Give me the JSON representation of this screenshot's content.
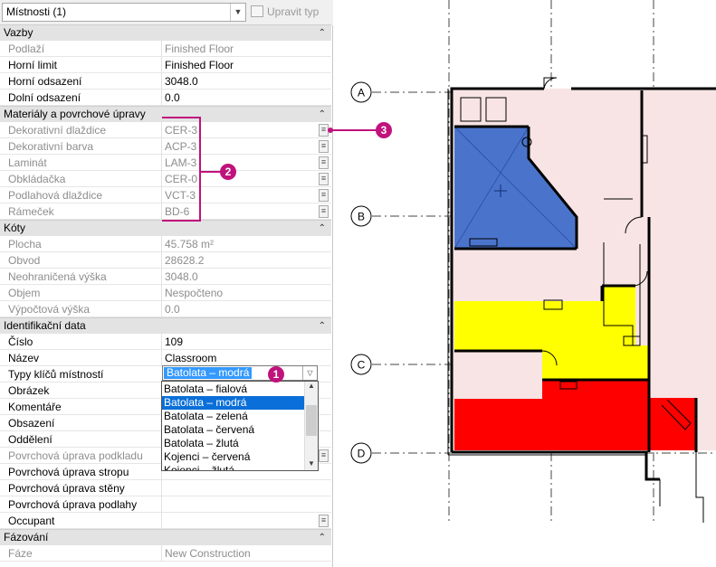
{
  "header": {
    "type_selector": "Místnosti (1)",
    "edit_type": "Upravit typ"
  },
  "groups": {
    "constraints": "Vazby",
    "materials": "Materiály a povrchové úpravy",
    "dimensions": "Kóty",
    "identity": "Identifikační data",
    "phasing": "Fázování"
  },
  "constraints": [
    {
      "label": "Podlaží",
      "value": "Finished Floor"
    },
    {
      "label": "Horní limit",
      "value": "Finished Floor"
    },
    {
      "label": "Horní odsazení",
      "value": "3048.0"
    },
    {
      "label": "Dolní odsazení",
      "value": "0.0"
    }
  ],
  "materials": [
    {
      "label": "Dekorativní dlaždice",
      "value": "CER-3"
    },
    {
      "label": "Dekorativní barva",
      "value": "ACP-3"
    },
    {
      "label": "Laminát",
      "value": "LAM-3"
    },
    {
      "label": "Obkládačka",
      "value": "CER-0"
    },
    {
      "label": "Podlahová dlaždice",
      "value": "VCT-3"
    },
    {
      "label": "Rámeček",
      "value": "BD-6"
    }
  ],
  "dimensions": [
    {
      "label": "Plocha",
      "value": "45.758 m²"
    },
    {
      "label": "Obvod",
      "value": "28628.2"
    },
    {
      "label": "Neohraničená výška",
      "value": "3048.0"
    },
    {
      "label": "Objem",
      "value": "Nespočteno"
    },
    {
      "label": "Výpočtová výška",
      "value": "0.0"
    }
  ],
  "identity": [
    {
      "label": "Číslo",
      "value": "109"
    },
    {
      "label": "Název",
      "value": "Classroom"
    },
    {
      "label": "Typy klíčů místností",
      "value": "Batolata – modrá"
    },
    {
      "label": "Obrázek",
      "value": ""
    },
    {
      "label": "Komentáře",
      "value": ""
    },
    {
      "label": "Obsazení",
      "value": ""
    },
    {
      "label": "Oddělení",
      "value": ""
    },
    {
      "label": "Povrchová úprava podkladu",
      "value": ""
    },
    {
      "label": "Povrchová úprava stropu",
      "value": ""
    },
    {
      "label": "Povrchová úprava stěny",
      "value": ""
    },
    {
      "label": "Povrchová úprava podlahy",
      "value": ""
    },
    {
      "label": "Occupant",
      "value": ""
    }
  ],
  "phasing": [
    {
      "label": "Fáze",
      "value": "New Construction"
    }
  ],
  "dropdown_options": [
    "Batolata – fialová",
    "Batolata – modrá",
    "Batolata – zelená",
    "Batolata – červená",
    "Batolata – žlutá",
    "Kojenci – červená",
    "Kojenci – žlutá"
  ],
  "dropdown_selected": "Batolata – modrá",
  "callouts": [
    "1",
    "2",
    "3"
  ],
  "grid_labels": [
    "A",
    "B",
    "C",
    "D"
  ],
  "colors": {
    "callout": "#c0127c",
    "room_blue": "#4a74cc",
    "room_yellow": "#ffff00",
    "room_red": "#ff0000",
    "room_pink": "#f8e4e4",
    "selection": "#3399ff"
  }
}
